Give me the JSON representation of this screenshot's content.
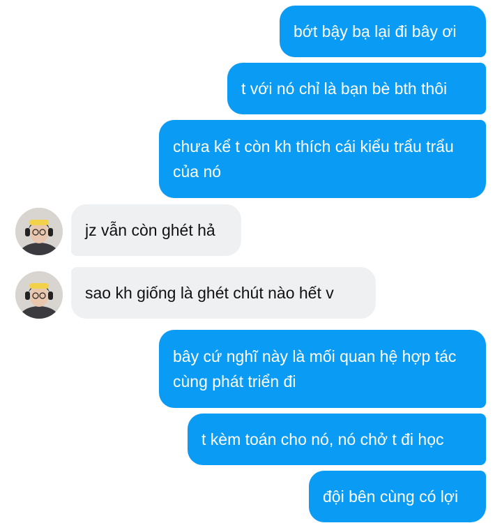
{
  "conversation": {
    "messages": [
      {
        "direction": "outgoing",
        "text": "bớt bậy bạ lại đi bây ơi"
      },
      {
        "direction": "outgoing",
        "text": "t với nó chỉ là bạn bè bth thôi"
      },
      {
        "direction": "outgoing",
        "text": "chưa kể t còn kh thích cái kiểu trẩu trẩu của nó"
      },
      {
        "direction": "incoming",
        "text": "jz vẫn còn ghét hả"
      },
      {
        "direction": "incoming",
        "text": "sao kh giống là ghét chút nào hết v"
      },
      {
        "direction": "outgoing",
        "text": "bây cứ nghĩ này là mối quan hệ hợp tác cùng phát triển đi"
      },
      {
        "direction": "outgoing",
        "text": "t kèm toán cho nó, nó chở t đi học"
      },
      {
        "direction": "outgoing",
        "text": "đội bên cùng có lợi"
      }
    ]
  },
  "colors": {
    "outgoing_bubble": "#0a9cf5",
    "incoming_bubble": "#eff0f2",
    "outgoing_text": "#ffffff",
    "incoming_text": "#111111"
  }
}
